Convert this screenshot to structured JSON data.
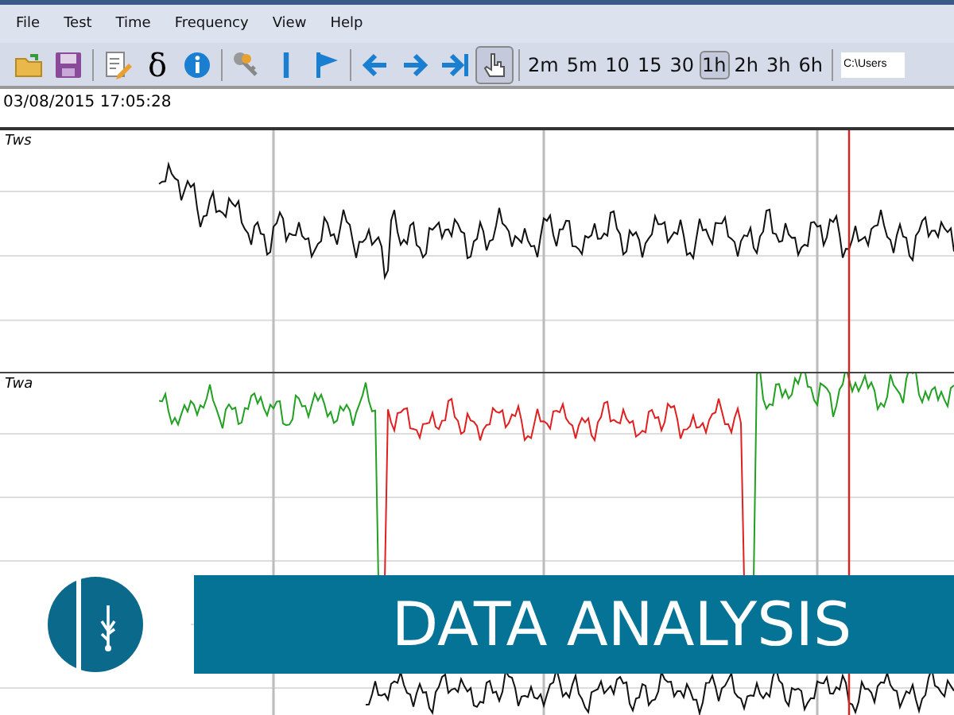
{
  "menu": [
    "File",
    "Test",
    "Time",
    "Frequency",
    "View",
    "Help"
  ],
  "toolbar": {
    "tools": [
      {
        "kind": "folder"
      },
      {
        "kind": "save"
      },
      {
        "kind": "sep"
      },
      {
        "kind": "edit"
      },
      {
        "kind": "glyph",
        "label": "δ"
      },
      {
        "kind": "info"
      },
      {
        "kind": "sep"
      },
      {
        "kind": "keys"
      },
      {
        "kind": "bar"
      },
      {
        "kind": "flag"
      },
      {
        "kind": "sep"
      },
      {
        "kind": "left"
      },
      {
        "kind": "right"
      },
      {
        "kind": "end"
      },
      {
        "kind": "hand",
        "selected": true
      },
      {
        "kind": "sep"
      }
    ],
    "ranges": [
      {
        "label": "2m",
        "selected": false
      },
      {
        "label": "5m",
        "selected": false
      },
      {
        "label": "10",
        "selected": false
      },
      {
        "label": "15",
        "selected": false
      },
      {
        "label": "30",
        "selected": false
      },
      {
        "label": "1h",
        "selected": true
      },
      {
        "label": "2h",
        "selected": false
      },
      {
        "label": "3h",
        "selected": false
      },
      {
        "label": "6h",
        "selected": false
      }
    ],
    "path": "C:\\Users"
  },
  "timestamp": "03/08/2015 17:05:28",
  "panels": [
    {
      "label": "Tws",
      "kind": "speed"
    },
    {
      "label": "Twa",
      "kind": "angle"
    }
  ],
  "banner": {
    "title": "DATA ANALYSIS"
  }
}
